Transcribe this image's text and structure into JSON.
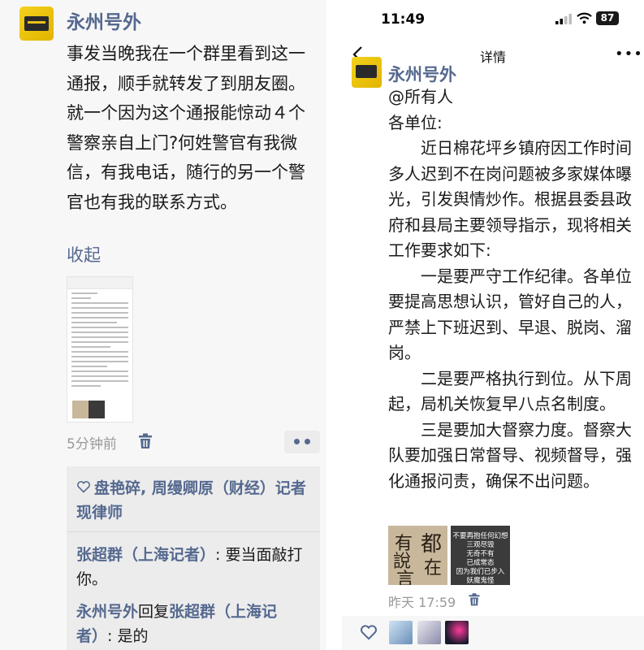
{
  "left": {
    "author": "永州号外",
    "body": "事发当晚我在一个群里看到这一通报，顺手就转发了到朋友圈。就一个因为这个通报能惊动４个警察亲自上门?何姓警官有我微信，有我电话，随行的另一个警官也有我的联系方式。",
    "collapse_label": "收起",
    "timestamp": "5分钟前",
    "likes": "盘艳碎, 周缦卿原（财经）记者现律师",
    "comments": [
      {
        "name": "张超群（上海记者）",
        "text": ": 要当面敲打你。"
      },
      {
        "name": "永州号外",
        "reply_word": "回复",
        "reply_to": "张超群（上海记者）",
        "text": ": 是的"
      }
    ]
  },
  "right": {
    "status_time": "11:49",
    "battery": "87",
    "nav_title": "详情",
    "author": "永州号外",
    "mention": "@所有人",
    "salutation": "各单位:",
    "paragraphs": [
      "近日棉花坪乡镇府因工作时间多人迟到不在岗问题被多家媒体曝光，引发舆情炒作。根据县委县政府和县局主要领导指示，现将相关工作要求如下:",
      "一是要严守工作纪律。各单位要提高思想认识，管好自己的人，严禁上下班迟到、早退、脱岗、溜岗。",
      "二是要严格执行到位。从下周起，局机关恢复早八点名制度。",
      "三是要加大督察力度。督察大队要加强日常督导、视频督导，强化通报问责，确保不出问题。"
    ],
    "image2_lines": [
      "不要再抱任何幻想",
      "三观尽毁",
      "无奇不有",
      "已成常态",
      "因为我们已步入",
      "妖魔鬼怪"
    ],
    "timestamp": "昨天 17:59"
  },
  "colors": {
    "link": "#55698f",
    "text": "#1a1a1a",
    "meta": "#999999"
  }
}
